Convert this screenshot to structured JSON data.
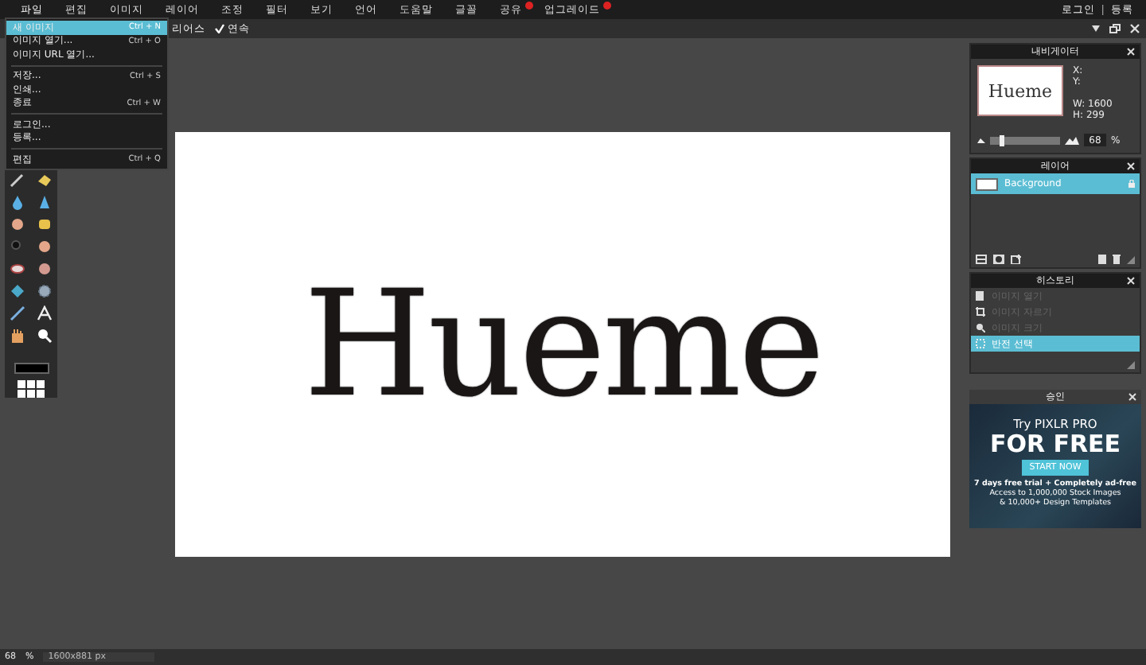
{
  "menu_bar": {
    "items": [
      {
        "label": "파일",
        "selected": true,
        "badge": false
      },
      {
        "label": "편집",
        "selected": false,
        "badge": false
      },
      {
        "label": "이미지",
        "selected": false,
        "badge": false
      },
      {
        "label": "레이어",
        "selected": false,
        "badge": false
      },
      {
        "label": "조정",
        "selected": false,
        "badge": false
      },
      {
        "label": "필터",
        "selected": false,
        "badge": false
      },
      {
        "label": "보기",
        "selected": false,
        "badge": false
      },
      {
        "label": "언어",
        "selected": false,
        "badge": false
      },
      {
        "label": "도움말",
        "selected": false,
        "badge": false
      },
      {
        "label": "글꼴",
        "selected": false,
        "badge": false
      },
      {
        "label": "공유",
        "selected": false,
        "badge": true
      },
      {
        "label": "업그레이드",
        "selected": false,
        "badge": true
      }
    ],
    "account": [
      "로그인",
      "등록"
    ],
    "account_separator": "|"
  },
  "options_bar": {
    "partial_label": "리어스",
    "options": [
      {
        "label": "연속",
        "checked": true
      }
    ]
  },
  "file_menu": {
    "items": [
      {
        "kind": "item",
        "label": "새 이미지",
        "shortcut": "Ctrl + N",
        "selected": true
      },
      {
        "kind": "item",
        "label": "이미지 열기...",
        "shortcut": "Ctrl + O",
        "selected": false
      },
      {
        "kind": "item",
        "label": "이미지 URL 열기...",
        "selected": false
      },
      {
        "kind": "separator"
      },
      {
        "kind": "item",
        "label": "저장...",
        "shortcut": "Ctrl + S",
        "selected": false
      },
      {
        "kind": "item",
        "label": "인쇄...",
        "selected": false
      },
      {
        "kind": "item",
        "label": "종료",
        "shortcut": "Ctrl + W",
        "selected": false
      },
      {
        "kind": "separator"
      },
      {
        "kind": "item",
        "label": "로그인...",
        "selected": false
      },
      {
        "kind": "item",
        "label": "등록...",
        "selected": false
      },
      {
        "kind": "separator"
      },
      {
        "kind": "item",
        "label": "편집",
        "shortcut": "Ctrl + Q",
        "selected": false
      }
    ]
  },
  "canvas": {
    "text": "Hueme"
  },
  "navigator": {
    "title": "내비게이터",
    "thumbnail_text": "Hueme",
    "x_label": "X:",
    "y_label": "Y:",
    "w_label": "W:",
    "w_value": "1600",
    "h_label": "H:",
    "h_value": "299",
    "zoom_value": "68",
    "zoom_unit": "%",
    "level": 0.15
  },
  "layers": {
    "title": "레이어",
    "items": [
      {
        "name": "Background",
        "selected": true,
        "locked": true
      }
    ]
  },
  "history": {
    "title": "히스토리",
    "items": [
      {
        "label": "이미지 열기",
        "selected": false
      },
      {
        "label": "이미지 자르기",
        "selected": false
      },
      {
        "label": "이미지 크기",
        "selected": false
      },
      {
        "label": "반전 선택",
        "selected": true
      }
    ]
  },
  "ad": {
    "title": "승인",
    "headline": "Try PIXLR PRO",
    "big": "FOR FREE",
    "button": "START NOW",
    "lines": [
      "7 days free trial + Completely ad-free",
      "Access to 1,000,000 Stock Images",
      "& 10,000+ Design Templates"
    ]
  },
  "status_bar": {
    "zoom": "68",
    "unit": "%",
    "size": "1600x881 px"
  }
}
